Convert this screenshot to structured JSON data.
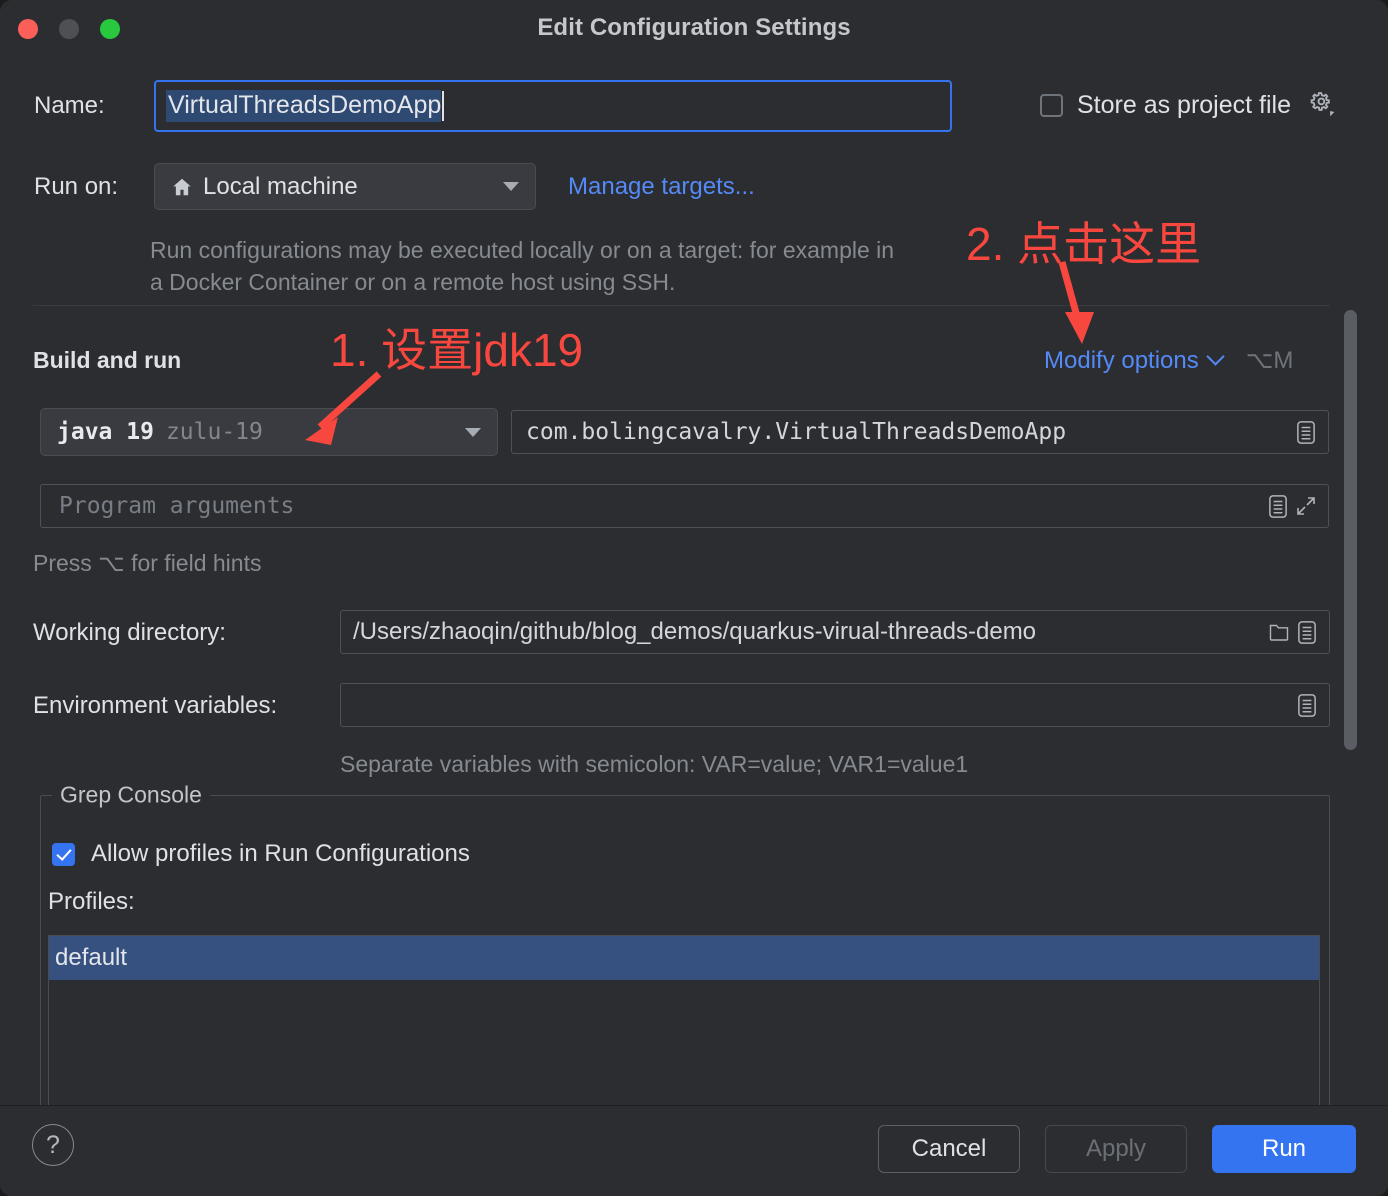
{
  "window": {
    "title": "Edit Configuration Settings",
    "traffic_lights": [
      "close",
      "minimize",
      "maximize"
    ]
  },
  "form": {
    "name_label": "Name:",
    "name_value": "VirtualThreadsDemoApp",
    "store_as_project_file_label": "Store as project file",
    "store_as_project_file_checked": false,
    "run_on_label": "Run on:",
    "run_on_value": "Local machine",
    "manage_targets_label": "Manage targets...",
    "run_on_description": "Run configurations may be executed locally or on a target: for example in a Docker Container or on a remote host using SSH."
  },
  "build_and_run": {
    "section_title": "Build and run",
    "modify_options_label": "Modify options",
    "modify_options_shortcut": "⌥M",
    "jdk_name": "java 19",
    "jdk_vendor": "zulu-19",
    "main_class": "com.bolingcavalry.VirtualThreadsDemoApp",
    "program_arguments_placeholder": "Program arguments",
    "field_hint": "Press ⌥ for field hints",
    "working_directory_label": "Working directory:",
    "working_directory_value": "/Users/zhaoqin/github/blog_demos/quarkus-virual-threads-demo",
    "environment_variables_label": "Environment variables:",
    "environment_variables_value": "",
    "environment_variables_hint": "Separate variables with semicolon: VAR=value; VAR1=value1"
  },
  "grep_console": {
    "group_title": "Grep Console",
    "allow_profiles_label": "Allow profiles in Run Configurations",
    "allow_profiles_checked": true,
    "profiles_label": "Profiles:",
    "profiles": [
      "default"
    ],
    "selected_profile": "default"
  },
  "footer": {
    "help_label": "?",
    "cancel_label": "Cancel",
    "apply_label": "Apply",
    "apply_disabled": true,
    "run_label": "Run"
  },
  "annotations": {
    "step1": "1. 设置jdk19",
    "step2": "2. 点击这里",
    "color": "#f8473e"
  },
  "colors": {
    "dialog_bg": "#2b2d30",
    "accent_blue": "#3574f0",
    "link_blue": "#548af7",
    "selection_blue": "#36517f",
    "text_primary": "#dfe1e5",
    "text_dim": "#868a91",
    "annotation_red": "#f8473e"
  }
}
